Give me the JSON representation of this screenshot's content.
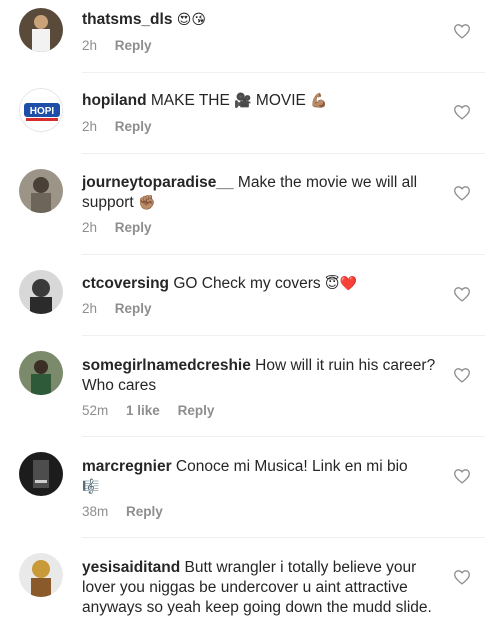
{
  "comments": [
    {
      "username": "thatsms_dls",
      "text": "",
      "emoji": "😍😘",
      "time": "2h",
      "likes": "",
      "reply": "Reply"
    },
    {
      "username": "hopiland",
      "text": "MAKE THE",
      "emoji": "🎥",
      "text2": "MOVIE",
      "emoji2": "💪🏽",
      "time": "2h",
      "likes": "",
      "reply": "Reply"
    },
    {
      "username": "journeytoparadise__",
      "text": "Make the movie we will all support",
      "emoji": "✊🏽",
      "time": "2h",
      "likes": "",
      "reply": "Reply"
    },
    {
      "username": "ctcoversing",
      "text": "GO Check my covers",
      "emoji": "😇❤️",
      "time": "2h",
      "likes": "",
      "reply": "Reply"
    },
    {
      "username": "somegirlnamedcreshie",
      "text": "How will it ruin his career? Who cares",
      "emoji": "",
      "time": "52m",
      "likes": "1 like",
      "reply": "Reply"
    },
    {
      "username": "marcregnier",
      "text": "Conoce mi Musica!  Link en mi bio",
      "emoji": "🎼",
      "time": "38m",
      "likes": "",
      "reply": "Reply"
    },
    {
      "username": "yesisaiditand",
      "text": "Butt wrangler i totally believe your lover you niggas be undercover u aint attractive anyways so yeah keep going down the mudd slide.",
      "emoji": "",
      "time": "",
      "likes": "",
      "reply": ""
    }
  ],
  "avatar_logo_text": "HOPI",
  "colors": {
    "meta": "#8e8e8e",
    "text": "#262626",
    "divider": "#efefef",
    "hopi_blue": "#1d4fa8",
    "hopi_red": "#d62d2d"
  }
}
